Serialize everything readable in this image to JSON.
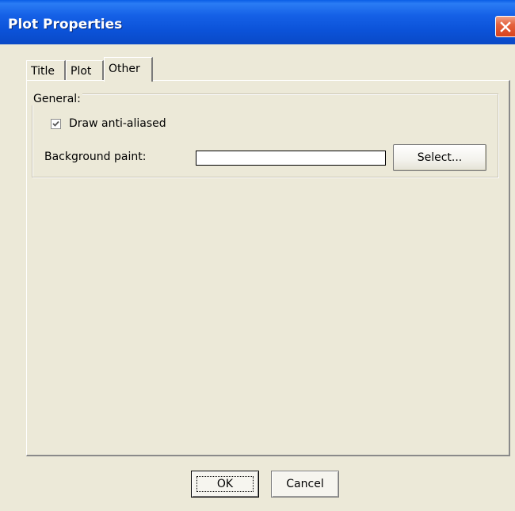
{
  "window": {
    "title": "Plot Properties"
  },
  "tabs": [
    {
      "label": "Title",
      "active": false
    },
    {
      "label": "Plot",
      "active": false
    },
    {
      "label": "Other",
      "active": true
    }
  ],
  "general": {
    "legend": "General:",
    "anti_aliased": {
      "label": "Draw anti-aliased",
      "checked": true
    },
    "background": {
      "label": "Background paint:",
      "value_color": "#ffffff",
      "select_label": "Select..."
    }
  },
  "footer": {
    "ok_label": "OK",
    "cancel_label": "Cancel"
  },
  "colors": {
    "titlebar": "#0b52d8",
    "dialog_bg": "#ece9d8",
    "close_button": "#d8431c"
  }
}
